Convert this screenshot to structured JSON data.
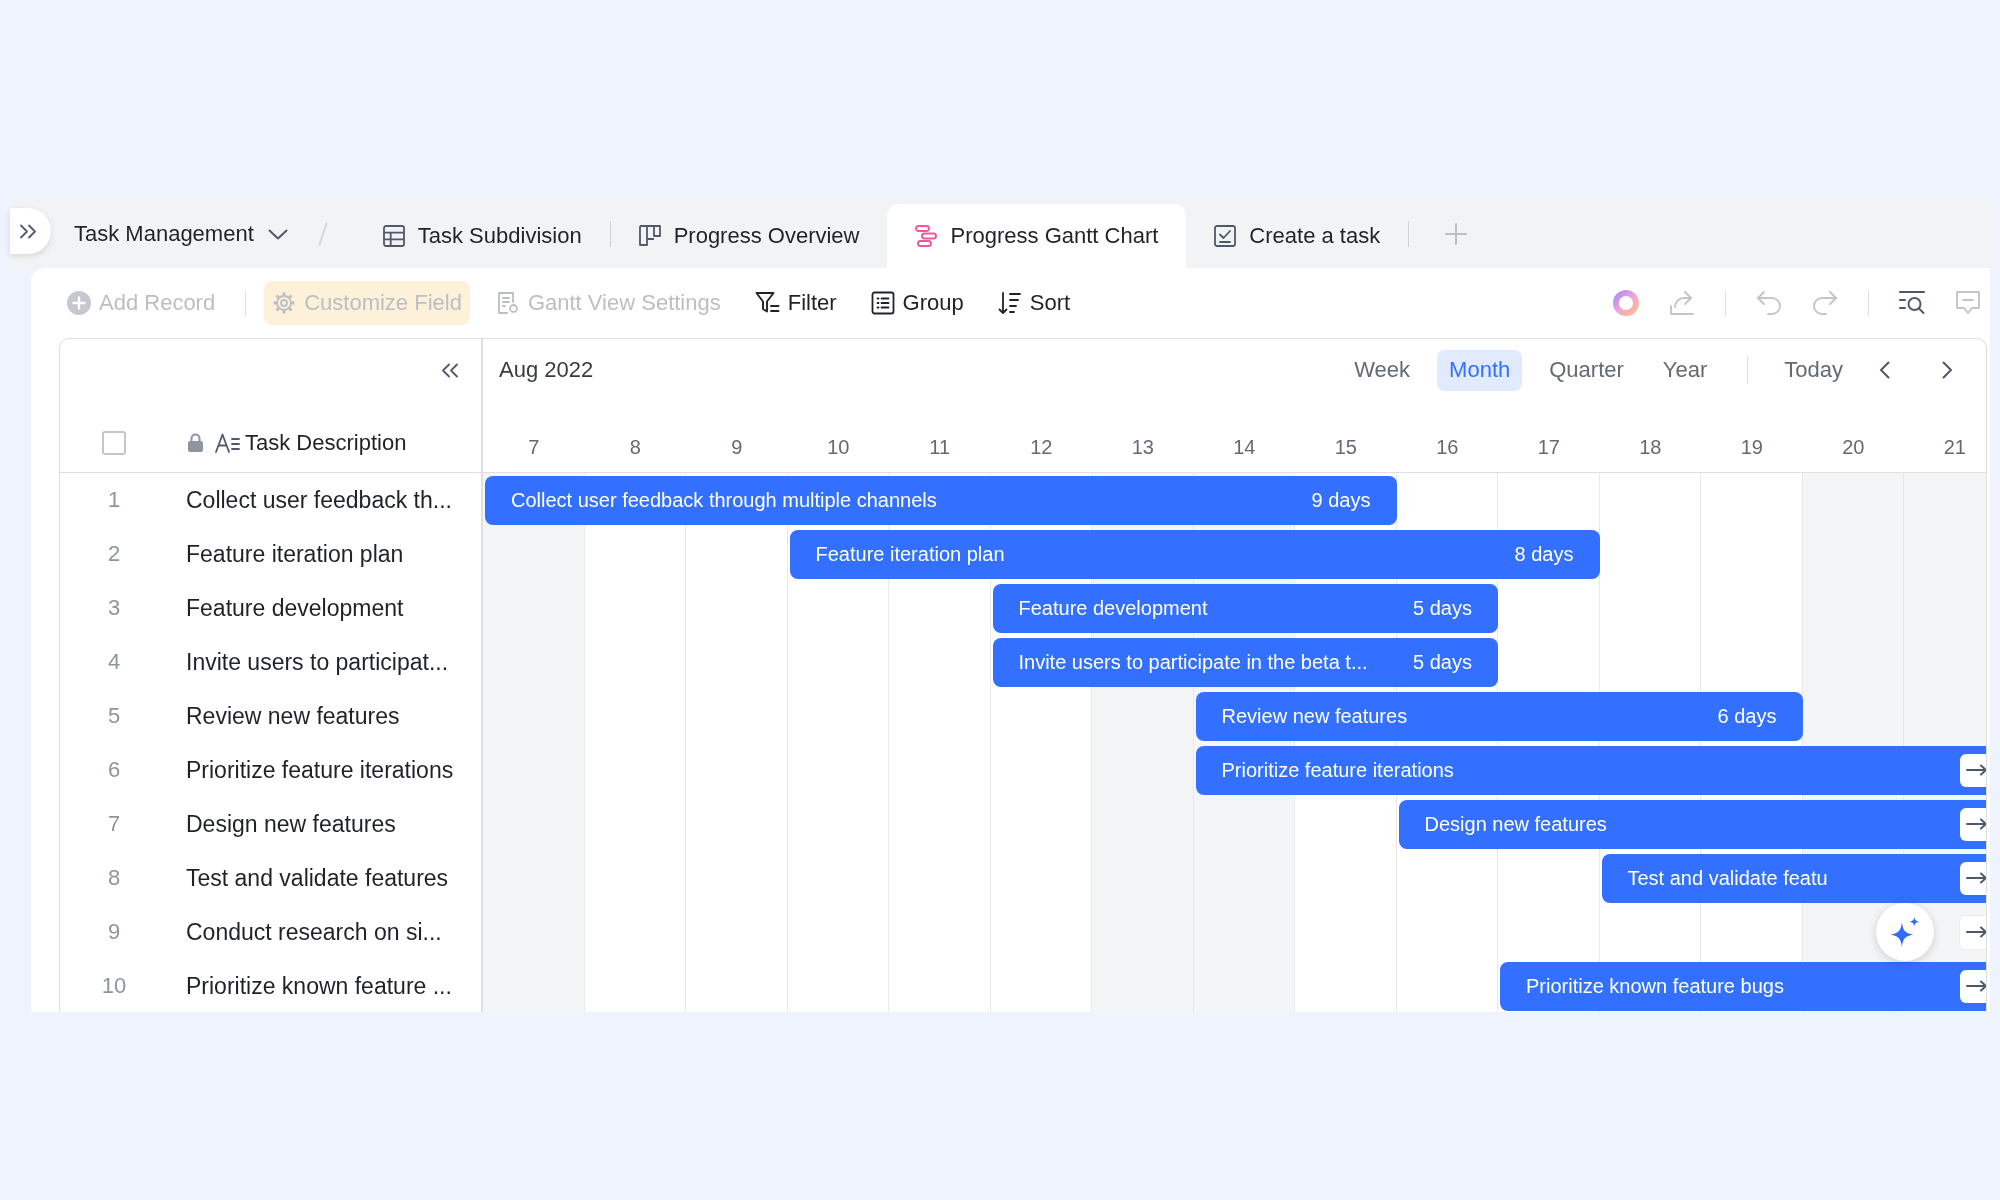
{
  "breadcrumb": {
    "title": "Task Management"
  },
  "tabs": [
    {
      "label": "Task Subdivision",
      "kind": "grid",
      "selected": false
    },
    {
      "label": "Progress Overview",
      "kind": "kanban",
      "selected": false
    },
    {
      "label": "Progress Gantt Chart",
      "kind": "gantt",
      "selected": true
    },
    {
      "label": "Create a task",
      "kind": "form",
      "selected": false
    }
  ],
  "toolbar": {
    "actions": [
      {
        "label": "Add Record",
        "kind": "add",
        "disabled": true,
        "highlighted": false
      },
      {
        "label": "Customize Field",
        "kind": "field",
        "disabled": true,
        "highlighted": true
      },
      {
        "label": "Gantt View Settings",
        "kind": "settings",
        "disabled": true,
        "highlighted": false
      },
      {
        "label": "Filter",
        "kind": "filter",
        "disabled": false,
        "highlighted": false
      },
      {
        "label": "Group",
        "kind": "group",
        "disabled": false,
        "highlighted": false
      },
      {
        "label": "Sort",
        "kind": "sort",
        "disabled": false,
        "highlighted": false
      }
    ]
  },
  "gantt": {
    "period": "Aug 2022",
    "scales": [
      {
        "label": "Week",
        "selected": false
      },
      {
        "label": "Month",
        "selected": true
      },
      {
        "label": "Quarter",
        "selected": false
      },
      {
        "label": "Year",
        "selected": false
      }
    ],
    "today": "Today",
    "select_all": {
      "checked": false
    },
    "column_header": "Task Description",
    "days": [
      {
        "label": "7",
        "weekend": true
      },
      {
        "label": "8",
        "weekend": false
      },
      {
        "label": "9",
        "weekend": false
      },
      {
        "label": "10",
        "weekend": false
      },
      {
        "label": "11",
        "weekend": false
      },
      {
        "label": "12",
        "weekend": false
      },
      {
        "label": "13",
        "weekend": true
      },
      {
        "label": "14",
        "weekend": true
      },
      {
        "label": "15",
        "weekend": false
      },
      {
        "label": "16",
        "weekend": false
      },
      {
        "label": "17",
        "weekend": false
      },
      {
        "label": "18",
        "weekend": false
      },
      {
        "label": "19",
        "weekend": false
      },
      {
        "label": "20",
        "weekend": true
      },
      {
        "label": "21",
        "weekend": true
      }
    ],
    "tasks": [
      {
        "number": "1",
        "name": "Collect user feedback th...",
        "bar": {
          "label": "Collect user feedback through multiple channels",
          "duration": "9 days",
          "cells": [
            {
              "kind": "filled"
            },
            {
              "kind": "filled"
            },
            {
              "kind": "filled"
            },
            {
              "kind": "filled"
            },
            {
              "kind": "filled"
            },
            {
              "kind": "filled"
            },
            {
              "kind": "filled"
            },
            {
              "kind": "filled"
            },
            {
              "kind": "filled"
            },
            {
              "kind": "empty"
            },
            {
              "kind": "empty"
            },
            {
              "kind": "empty"
            },
            {
              "kind": "empty"
            },
            {
              "kind": "empty"
            },
            {
              "kind": "empty"
            }
          ],
          "continues": false
        }
      },
      {
        "number": "2",
        "name": "Feature iteration plan",
        "bar": {
          "label": "Feature iteration plan",
          "duration": "8 days",
          "cells": [
            {
              "kind": "empty"
            },
            {
              "kind": "empty"
            },
            {
              "kind": "empty"
            },
            {
              "kind": "filled"
            },
            {
              "kind": "filled"
            },
            {
              "kind": "filled"
            },
            {
              "kind": "filled"
            },
            {
              "kind": "filled"
            },
            {
              "kind": "filled"
            },
            {
              "kind": "filled"
            },
            {
              "kind": "filled"
            },
            {
              "kind": "empty"
            },
            {
              "kind": "empty"
            },
            {
              "kind": "empty"
            },
            {
              "kind": "empty"
            }
          ],
          "continues": false
        }
      },
      {
        "number": "3",
        "name": "Feature development",
        "bar": {
          "label": "Feature development",
          "duration": "5 days",
          "cells": [
            {
              "kind": "empty"
            },
            {
              "kind": "empty"
            },
            {
              "kind": "empty"
            },
            {
              "kind": "empty"
            },
            {
              "kind": "empty"
            },
            {
              "kind": "filled"
            },
            {
              "kind": "filled"
            },
            {
              "kind": "filled"
            },
            {
              "kind": "filled"
            },
            {
              "kind": "filled"
            },
            {
              "kind": "empty"
            },
            {
              "kind": "empty"
            },
            {
              "kind": "empty"
            },
            {
              "kind": "empty"
            },
            {
              "kind": "empty"
            }
          ],
          "continues": false
        }
      },
      {
        "number": "4",
        "name": "Invite users to participat...",
        "bar": {
          "label": "Invite users to participate in the beta t...",
          "duration": "5 days",
          "cells": [
            {
              "kind": "empty"
            },
            {
              "kind": "empty"
            },
            {
              "kind": "empty"
            },
            {
              "kind": "empty"
            },
            {
              "kind": "empty"
            },
            {
              "kind": "filled"
            },
            {
              "kind": "filled"
            },
            {
              "kind": "filled"
            },
            {
              "kind": "filled"
            },
            {
              "kind": "filled"
            },
            {
              "kind": "empty"
            },
            {
              "kind": "empty"
            },
            {
              "kind": "empty"
            },
            {
              "kind": "empty"
            },
            {
              "kind": "empty"
            }
          ],
          "continues": false
        }
      },
      {
        "number": "5",
        "name": "Review new features",
        "bar": {
          "label": "Review new features",
          "duration": "6 days",
          "cells": [
            {
              "kind": "empty"
            },
            {
              "kind": "empty"
            },
            {
              "kind": "empty"
            },
            {
              "kind": "empty"
            },
            {
              "kind": "empty"
            },
            {
              "kind": "empty"
            },
            {
              "kind": "empty"
            },
            {
              "kind": "filled"
            },
            {
              "kind": "filled"
            },
            {
              "kind": "filled"
            },
            {
              "kind": "filled"
            },
            {
              "kind": "filled"
            },
            {
              "kind": "filled"
            },
            {
              "kind": "empty"
            },
            {
              "kind": "empty"
            }
          ],
          "continues": false
        }
      },
      {
        "number": "6",
        "name": "Prioritize feature iterations",
        "bar": {
          "label": "Prioritize feature iterations",
          "cells": [
            {
              "kind": "empty"
            },
            {
              "kind": "empty"
            },
            {
              "kind": "empty"
            },
            {
              "kind": "empty"
            },
            {
              "kind": "empty"
            },
            {
              "kind": "empty"
            },
            {
              "kind": "empty"
            },
            {
              "kind": "filled"
            },
            {
              "kind": "filled"
            },
            {
              "kind": "filled"
            },
            {
              "kind": "filled"
            },
            {
              "kind": "filled"
            },
            {
              "kind": "filled"
            },
            {
              "kind": "filled"
            },
            {
              "kind": "filled"
            }
          ],
          "continues": true
        }
      },
      {
        "number": "7",
        "name": "Design new features",
        "bar": {
          "label": "Design new features",
          "cells": [
            {
              "kind": "empty"
            },
            {
              "kind": "empty"
            },
            {
              "kind": "empty"
            },
            {
              "kind": "empty"
            },
            {
              "kind": "empty"
            },
            {
              "kind": "empty"
            },
            {
              "kind": "empty"
            },
            {
              "kind": "empty"
            },
            {
              "kind": "empty"
            },
            {
              "kind": "filled"
            },
            {
              "kind": "filled"
            },
            {
              "kind": "filled"
            },
            {
              "kind": "filled"
            },
            {
              "kind": "filled"
            },
            {
              "kind": "filled"
            }
          ],
          "continues": true
        }
      },
      {
        "number": "8",
        "name": "Test and validate features",
        "bar": {
          "label": "Test and validate featu",
          "cells": [
            {
              "kind": "empty"
            },
            {
              "kind": "empty"
            },
            {
              "kind": "empty"
            },
            {
              "kind": "empty"
            },
            {
              "kind": "empty"
            },
            {
              "kind": "empty"
            },
            {
              "kind": "empty"
            },
            {
              "kind": "empty"
            },
            {
              "kind": "empty"
            },
            {
              "kind": "empty"
            },
            {
              "kind": "empty"
            },
            {
              "kind": "filled"
            },
            {
              "kind": "filled"
            },
            {
              "kind": "filled"
            },
            {
              "kind": "filled"
            }
          ],
          "continues": true
        }
      },
      {
        "number": "9",
        "name": "Conduct research on si...",
        "bar": {
          "cells": [
            {
              "kind": "empty"
            },
            {
              "kind": "empty"
            },
            {
              "kind": "empty"
            },
            {
              "kind": "empty"
            },
            {
              "kind": "empty"
            },
            {
              "kind": "empty"
            },
            {
              "kind": "empty"
            },
            {
              "kind": "empty"
            },
            {
              "kind": "empty"
            },
            {
              "kind": "empty"
            },
            {
              "kind": "empty"
            },
            {
              "kind": "empty"
            },
            {
              "kind": "empty"
            },
            {
              "kind": "empty"
            },
            {
              "kind": "empty"
            }
          ],
          "continues": true
        }
      },
      {
        "number": "10",
        "name": "Prioritize known feature ...",
        "bar": {
          "label": "Prioritize known feature bugs",
          "cells": [
            {
              "kind": "empty"
            },
            {
              "kind": "empty"
            },
            {
              "kind": "empty"
            },
            {
              "kind": "empty"
            },
            {
              "kind": "empty"
            },
            {
              "kind": "empty"
            },
            {
              "kind": "empty"
            },
            {
              "kind": "empty"
            },
            {
              "kind": "empty"
            },
            {
              "kind": "empty"
            },
            {
              "kind": "filled"
            },
            {
              "kind": "filled"
            },
            {
              "kind": "filled"
            },
            {
              "kind": "filled"
            },
            {
              "kind": "filled"
            }
          ],
          "continues": true
        }
      }
    ]
  }
}
